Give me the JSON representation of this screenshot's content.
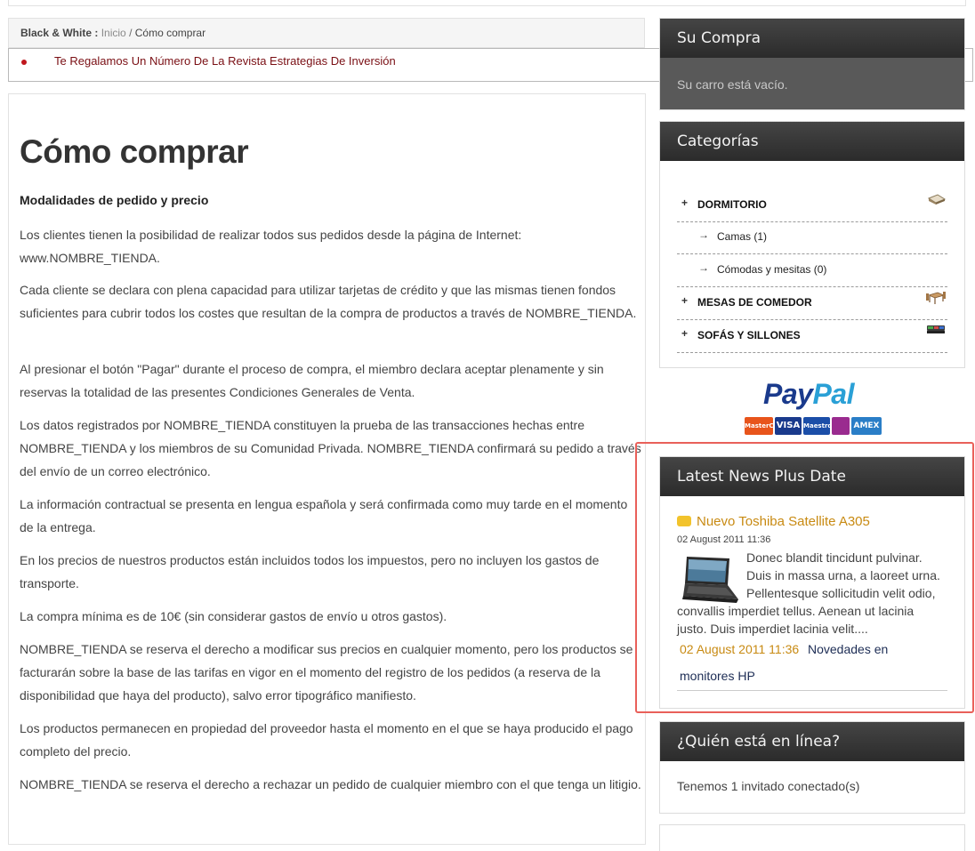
{
  "breadcrumb": {
    "site": "Black & White :",
    "home": "Inicio",
    "separator": "/",
    "current": "Cómo comprar"
  },
  "ticker": {
    "text": "Te Regalamos Un Número De La Revista Estrategias De Inversión"
  },
  "main": {
    "title": "Cómo comprar",
    "section_heading": "Modalidades de pedido y precio",
    "paragraphs": [
      "Los clientes tienen la posibilidad de realizar todos sus pedidos desde la página de Internet: www.NOMBRE_TIENDA.",
      "Cada cliente se declara con plena capacidad para utilizar tarjetas de crédito y que las mismas tienen fondos suficientes para cubrir todos los costes que resultan de la compra de productos a través de NOMBRE_TIENDA.",
      "Al presionar el botón \"Pagar\" durante el proceso de compra, el miembro declara aceptar plenamente y sin reservas la totalidad de las presentes Condiciones Generales de Venta.",
      "Los datos registrados por NOMBRE_TIENDA constituyen la prueba de las transacciones hechas entre NOMBRE_TIENDA y los miembros de su Comunidad Privada. NOMBRE_TIENDA confirmará su pedido a través del envío de un correo electrónico.",
      "La información contractual se presenta en lengua española y será confirmada como muy tarde en el momento de la entrega.",
      "En los precios de nuestros productos están incluidos todos los impuestos, pero no incluyen los gastos de transporte.",
      "La compra mínima es de 10€ (sin considerar gastos de envío u otros gastos).",
      "NOMBRE_TIENDA se reserva el derecho a modificar sus precios en cualquier momento, pero los productos se facturarán sobre la base de las tarifas en vigor en el momento del registro de los pedidos (a reserva de la disponibilidad que haya del producto), salvo error tipográfico manifiesto.",
      "Los productos permanecen en propiedad del proveedor hasta el momento en el que se haya producido el pago completo del precio.",
      "NOMBRE_TIENDA se reserva el derecho a rechazar un pedido de cualquier miembro con el que tenga un litigio."
    ]
  },
  "cart": {
    "title": "Su Compra",
    "empty_text": "Su carro está vacío."
  },
  "categories": {
    "title": "Categorías",
    "items": [
      {
        "marker": "+",
        "label": "DORMITORIO",
        "icon": "bed-thumbnail-icon"
      },
      {
        "marker": "→",
        "label": "Camas (1)"
      },
      {
        "marker": "→",
        "label": "Cómodas y mesitas (0)"
      },
      {
        "marker": "+",
        "label": "MESAS DE COMEDOR",
        "icon": "dining-table-thumbnail-icon"
      },
      {
        "marker": "+",
        "label": "SOFÁS Y SILLONES",
        "icon": "sofa-thumbnail-icon"
      }
    ]
  },
  "payment": {
    "logo_a": "Pay",
    "logo_b": "Pal",
    "cards": [
      "MasterCard",
      "VISA",
      "Maestro",
      "",
      "AMEX"
    ]
  },
  "news": {
    "title": "Latest News Plus Date",
    "item_title": "Nuevo Toshiba Satellite A305",
    "item_date": "02 August 2011 11:36",
    "item_text": "Donec blandit tincidunt pulvinar. Duis in massa urna, a laoreet urna. Pellentesque sollicitudin velit odio, convallis imperdiet tellus. Aenean ut lacinia justo. Duis imperdiet lacinia velit....",
    "next_date": "02 August 2011 11:36",
    "next_title_line1": "Novedades en",
    "next_title_line2": "monitores HP",
    "accent_color": "#c88a12"
  },
  "online": {
    "title": "¿Quién está en línea?",
    "text": "Tenemos 1 invitado conectado(s)"
  }
}
